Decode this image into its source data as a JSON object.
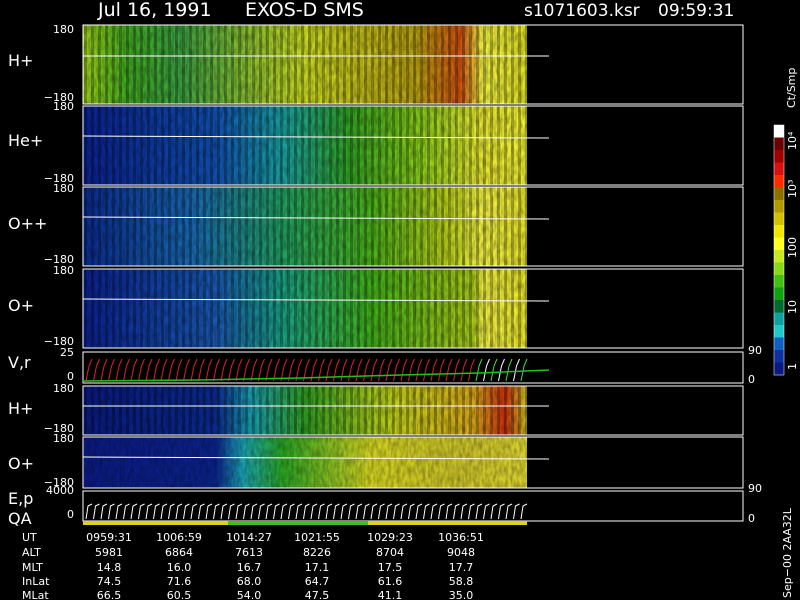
{
  "header": {
    "date": "Jul 16, 1991",
    "instrument": "EXOS-D SMS",
    "file": "s1071603.ksr",
    "time": "09:59:31"
  },
  "colorbar": {
    "unit": "Ct/Smp",
    "labels": [
      "10⁴",
      "10³",
      "100",
      "10",
      "1"
    ],
    "colors": [
      "#ffffff",
      "#6a0000",
      "#a00000",
      "#d81010",
      "#ff2a00",
      "#8a7000",
      "#b09a00",
      "#d4c200",
      "#f0e800",
      "#ffff20",
      "#c8e820",
      "#88d818",
      "#40c010",
      "#10a010",
      "#006a30",
      "#10a0a0",
      "#20c8c8",
      "#1060c0",
      "#1030a0",
      "#0a1a80"
    ]
  },
  "panels": [
    {
      "name": "H+",
      "ymax": "180",
      "ymin": "−180"
    },
    {
      "name": "He+",
      "ymax": "180",
      "ymin": "−180"
    },
    {
      "name": "O++",
      "ymax": "180",
      "ymin": "−180"
    },
    {
      "name": "O+",
      "ymax": "180",
      "ymin": "−180"
    },
    {
      "name": "V,r",
      "ymax": "25",
      "ymin": "0",
      "rmax": "90",
      "rmin": "0"
    },
    {
      "name": "H+",
      "ymax": "180",
      "ymin": "−180"
    },
    {
      "name": "O+",
      "ymax": "180",
      "ymin": "−180"
    },
    {
      "name": "E,p",
      "name2": "QA",
      "ymax": "4000",
      "ymin": "0",
      "rmax": "90",
      "rmin": "0"
    }
  ],
  "footer_label": "Sep−00 2AA32L",
  "ephemeris": {
    "row_labels": [
      "UT",
      "ALT",
      "MLT",
      "InLat",
      "MLat"
    ],
    "columns": [
      [
        "0959:31",
        "5981",
        "14.8",
        "74.5",
        "66.5"
      ],
      [
        "1006:59",
        "6864",
        "16.0",
        "71.6",
        "60.5"
      ],
      [
        "1014:27",
        "7613",
        "16.7",
        "68.0",
        "54.0"
      ],
      [
        "1021:55",
        "8226",
        "17.1",
        "64.7",
        "47.5"
      ],
      [
        "1029:23",
        "8704",
        "17.5",
        "61.6",
        "41.1"
      ],
      [
        "1036:51",
        "9048",
        "17.7",
        "58.8",
        "35.0"
      ]
    ]
  },
  "chart_data": {
    "type": "heatmap",
    "title": "Jul 16, 1991  EXOS-D SMS",
    "x_ticks": [
      "0959:31",
      "1006:59",
      "1014:27",
      "1021:55",
      "1029:23",
      "1036:51"
    ],
    "colorbar_scale": "log",
    "colorbar_range": [
      1,
      10000
    ],
    "series": [
      {
        "name": "H+",
        "yrange": [
          -180,
          180
        ]
      },
      {
        "name": "He+",
        "yrange": [
          -180,
          180
        ]
      },
      {
        "name": "O++",
        "yrange": [
          -180,
          180
        ]
      },
      {
        "name": "O+",
        "yrange": [
          -180,
          180
        ]
      },
      {
        "name": "V,r",
        "yrange": [
          0,
          25
        ],
        "right_range": [
          0,
          90
        ]
      },
      {
        "name": "H+",
        "yrange": [
          -180,
          180
        ]
      },
      {
        "name": "O+",
        "yrange": [
          -180,
          180
        ]
      },
      {
        "name": "E,p",
        "yrange": [
          0,
          4000
        ],
        "right_range": [
          0,
          90
        ]
      }
    ]
  }
}
